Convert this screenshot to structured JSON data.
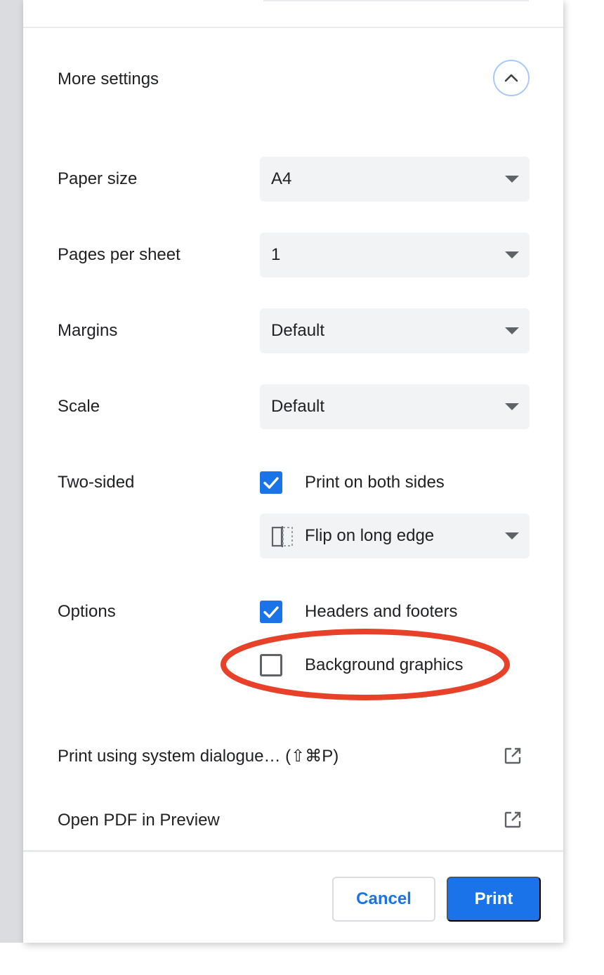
{
  "more_settings": {
    "label": "More settings"
  },
  "settings": {
    "paper_size": {
      "label": "Paper size",
      "value": "A4"
    },
    "pages_per_sheet": {
      "label": "Pages per sheet",
      "value": "1"
    },
    "margins": {
      "label": "Margins",
      "value": "Default"
    },
    "scale": {
      "label": "Scale",
      "value": "Default"
    },
    "two_sided": {
      "label": "Two-sided",
      "checkbox_label": "Print on both sides",
      "checked": true,
      "flip_value": "Flip on long edge"
    },
    "options": {
      "label": "Options",
      "headers_footers": {
        "label": "Headers and footers",
        "checked": true
      },
      "background_graphics": {
        "label": "Background graphics",
        "checked": false
      }
    }
  },
  "links": {
    "system_dialogue": "Print using system dialogue… (⇧⌘P)",
    "open_pdf": "Open PDF in Preview"
  },
  "buttons": {
    "cancel": "Cancel",
    "print": "Print"
  },
  "colors": {
    "accent": "#1a73e8",
    "annotation": "#e8412a"
  },
  "icons": {
    "collapse": "chevron-up-icon",
    "external": "open-in-new-icon",
    "flip": "flip-long-edge-icon"
  }
}
